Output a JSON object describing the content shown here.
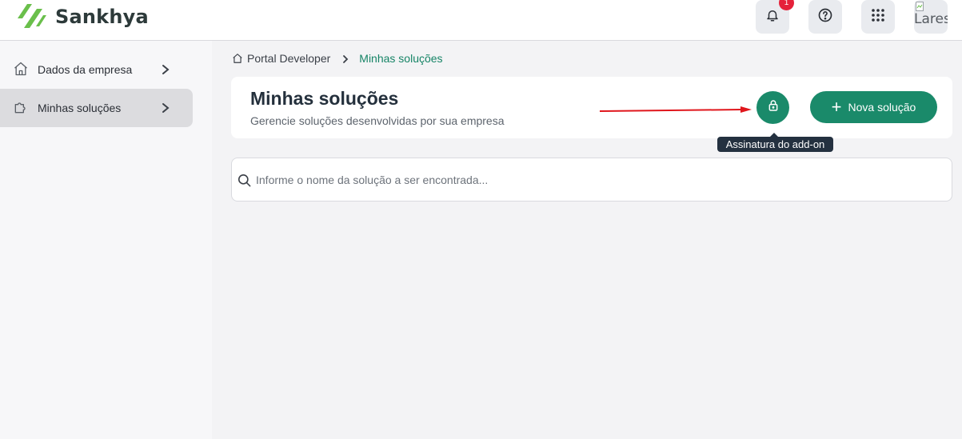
{
  "app": {
    "brand": "Sankhya",
    "brand_color": "#1a8a6a",
    "logo_color": "#6abf4b"
  },
  "topbar": {
    "notifications": {
      "icon": "bell-icon",
      "badge_count": "1"
    },
    "help": {
      "icon": "help-circle-icon"
    },
    "apps": {
      "icon": "grid-dots-icon"
    },
    "avatar": {
      "alt_text": "Lares"
    }
  },
  "sidebar": {
    "items": [
      {
        "label": "Dados da empresa",
        "icon": "home-icon",
        "active": false
      },
      {
        "label": "Minhas soluções",
        "icon": "puzzle-icon",
        "active": true
      }
    ]
  },
  "breadcrumb": {
    "items": [
      "Portal Developer",
      "Minhas soluções"
    ]
  },
  "header": {
    "title": "Minhas soluções",
    "subtitle": "Gerencie soluções desenvolvidas por sua empresa",
    "lock_button": {
      "icon": "lock-icon",
      "tooltip": "Assinatura do add-on"
    },
    "new_button": {
      "label": "Nova solução",
      "icon": "plus-icon"
    }
  },
  "search": {
    "placeholder": "Informe o nome da solução a ser encontrada...",
    "value": ""
  },
  "annotation": {
    "arrow_color": "#e0161c"
  }
}
